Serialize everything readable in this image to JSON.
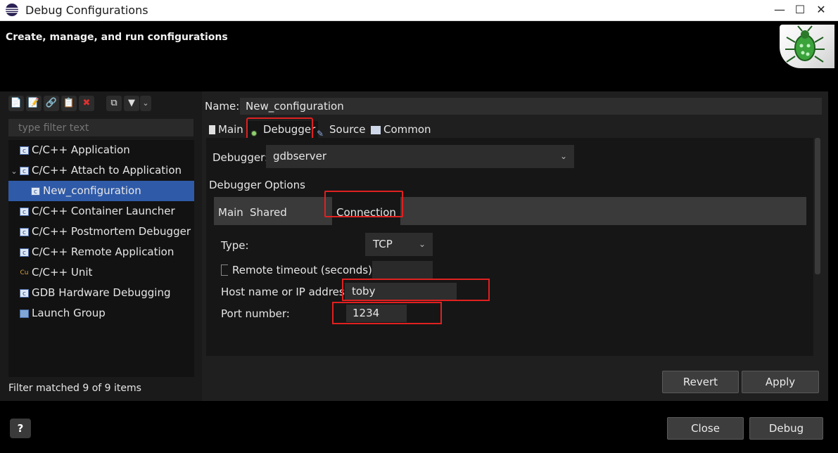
{
  "window": {
    "title": "Debug Configurations"
  },
  "header": {
    "subtitle": "Create, manage, and run configurations"
  },
  "left": {
    "filter_placeholder": "type filter text",
    "items": [
      {
        "label": "C/C++ Application",
        "icon": "c-app-icon"
      },
      {
        "label": "C/C++ Attach to Application",
        "icon": "c-app-icon",
        "expanded": true
      },
      {
        "label": "New_configuration",
        "icon": "c-app-icon",
        "selected": true,
        "child": true
      },
      {
        "label": "C/C++ Container Launcher",
        "icon": "c-app-icon"
      },
      {
        "label": "C/C++ Postmortem Debugger",
        "icon": "c-app-icon"
      },
      {
        "label": "C/C++ Remote Application",
        "icon": "c-app-icon"
      },
      {
        "label": "C/C++ Unit",
        "icon": "c-unit-icon"
      },
      {
        "label": "GDB Hardware Debugging",
        "icon": "c-app-icon"
      },
      {
        "label": "Launch Group",
        "icon": "launch-group-icon"
      }
    ],
    "status": "Filter matched 9 of 9 items"
  },
  "config": {
    "name_label": "Name:",
    "name_value": "New_configuration",
    "tabs": [
      "Main",
      "Debugger",
      "Source",
      "Common"
    ],
    "debugger_label": "Debugger:",
    "debugger_value": "gdbserver",
    "options_label": "Debugger Options",
    "subtabs": [
      "Main",
      "Shared Libraries",
      "Connection"
    ],
    "type_label": "Type:",
    "type_value": "TCP",
    "timeout_label": "Remote timeout (seconds):",
    "host_label": "Host name or IP address:",
    "host_value": "toby",
    "port_label": "Port number:",
    "port_value": "1234"
  },
  "buttons": {
    "revert": "Revert",
    "apply": "Apply",
    "close": "Close",
    "debug": "Debug",
    "help": "?"
  },
  "colors": {
    "highlight": "#e02020",
    "selection": "#2f5aa8"
  }
}
